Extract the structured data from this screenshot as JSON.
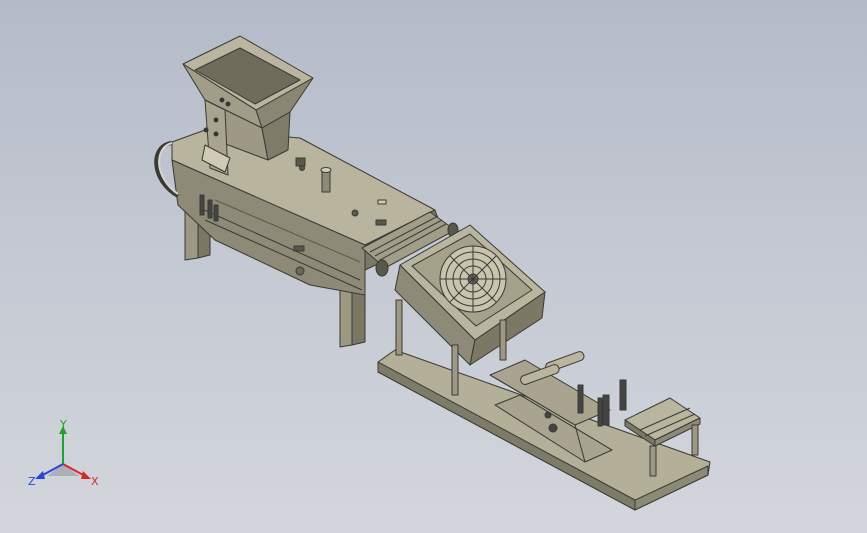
{
  "viewport": {
    "background_top": "#b4bbc8",
    "background_bottom": "#d3d6dc",
    "model_color": "#a8a490",
    "model_dark": "#6f6c5c",
    "edge_color": "#3a3a34"
  },
  "triad": {
    "x_label": "X",
    "y_label": "Y",
    "z_label": "Z",
    "x_color": "#d62a2a",
    "y_color": "#23a02d",
    "z_color": "#2a45d6"
  }
}
